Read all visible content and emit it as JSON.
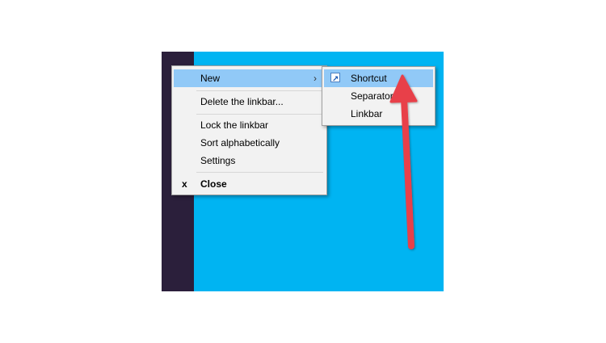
{
  "main_menu": {
    "new_label": "New",
    "new_chevron": "›",
    "delete_label": "Delete the linkbar...",
    "lock_label": "Lock the linkbar",
    "sort_label": "Sort alphabetically",
    "settings_label": "Settings",
    "close_glyph": "x",
    "close_label": "Close"
  },
  "sub_menu": {
    "shortcut_label": "Shortcut",
    "separator_label": "Separator",
    "linkbar_label": "Linkbar"
  },
  "colors": {
    "highlight": "#91c9f7",
    "desktop": "#00b4f2",
    "taskbar": "#2b1f3b",
    "annotation_arrow": "#e8414a"
  },
  "icons": {
    "shortcut_icon": "shortcut-arrow-icon",
    "annotation": "red-arrow-icon"
  }
}
